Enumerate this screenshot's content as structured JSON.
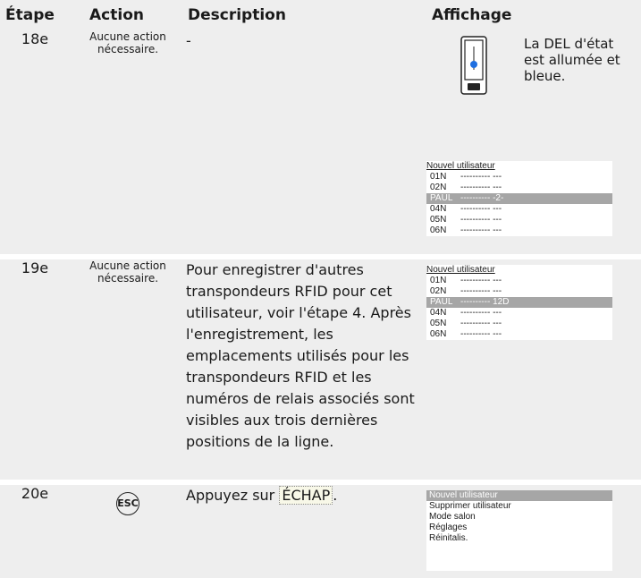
{
  "headers": {
    "step": "Étape",
    "action": "Action",
    "description": "Description",
    "display": "Affichage"
  },
  "steps": [
    {
      "num": "18e",
      "action_line1": "Aucune action",
      "action_line2": "nécessaire.",
      "description": "-",
      "led_text": "La DEL d'état est allumée et bleue.",
      "led_color": "#1f6fe0",
      "screen": {
        "title": "Nouvel utilisateur",
        "rows": [
          {
            "k": "01N",
            "v": "---------- ---"
          },
          {
            "k": "02N",
            "v": "---------- ---"
          },
          {
            "k": "PAUL",
            "v": "---------- -2-"
          },
          {
            "k": "04N",
            "v": "---------- ---"
          },
          {
            "k": "05N",
            "v": "---------- ---"
          },
          {
            "k": "06N",
            "v": "---------- ---"
          }
        ]
      }
    },
    {
      "num": "19e",
      "action_line1": "Aucune action",
      "action_line2": "nécessaire.",
      "description": "Pour enregistrer d'autres transpondeurs RFID pour cet utilisateur, voir l'étape 4. Après l'enregistrement, les emplacements utilisés pour les transpondeurs RFID et les numéros de relais associés sont visibles aux trois dernières positions de la ligne.",
      "screen": {
        "title": "Nouvel utilisateur",
        "rows": [
          {
            "k": "01N",
            "v": "---------- ---"
          },
          {
            "k": "02N",
            "v": "---------- ---"
          },
          {
            "k": "PAUL",
            "v": "---------- 12D"
          },
          {
            "k": "04N",
            "v": "---------- ---"
          },
          {
            "k": "05N",
            "v": "---------- ---"
          },
          {
            "k": "06N",
            "v": "---------- ---"
          }
        ]
      }
    },
    {
      "num": "20e",
      "esc_label": "ESC",
      "description_prefix": "Appuyez sur ",
      "description_key": "ÉCHAP",
      "description_suffix": ".",
      "menu": [
        "Nouvel utilisateur",
        "Supprimer utilisateur",
        "Mode salon",
        "Réglages",
        "Réinitalis."
      ]
    }
  ]
}
